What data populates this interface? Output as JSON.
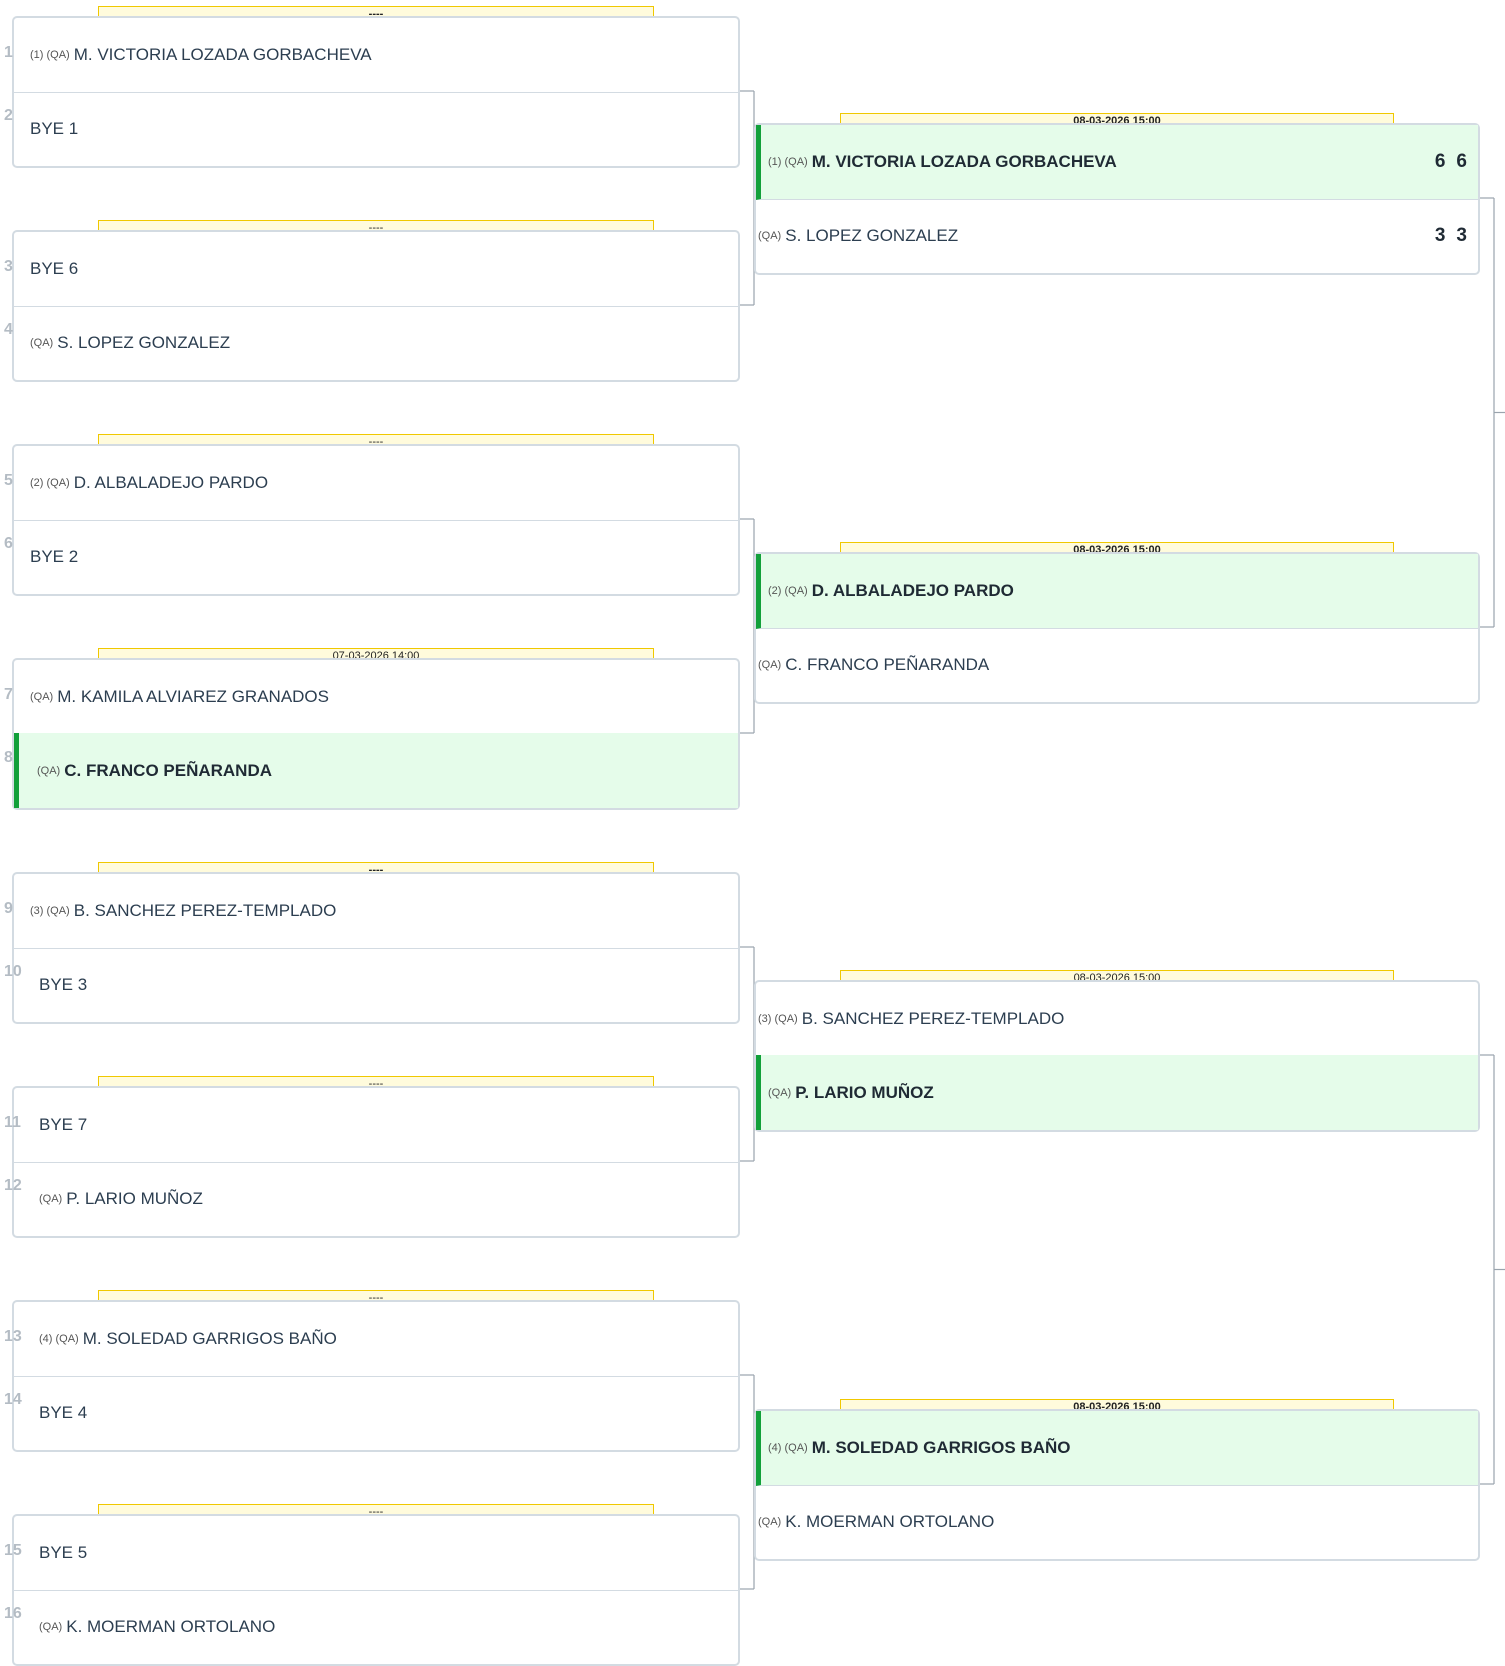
{
  "colors": {
    "winner_bg": "#e5fcea",
    "winner_bar": "#12a03a",
    "date_bg": "#fffbdc",
    "date_border": "#f0c800",
    "box_border": "#d3dbe2"
  },
  "rounds": [
    {
      "matches": [
        {
          "date": "----",
          "date_bold": true,
          "top": {
            "pos": "1",
            "seed": "(1) (QA)",
            "name": "M. VICTORIA LOZADA GORBACHEVA"
          },
          "bottom": {
            "pos": "2",
            "seed": "",
            "name": "BYE 1"
          }
        },
        {
          "date": "----",
          "date_bold": false,
          "top": {
            "pos": "3",
            "seed": "",
            "name": "BYE 6"
          },
          "bottom": {
            "pos": "4",
            "seed": "(QA)",
            "name": "S. LOPEZ GONZALEZ"
          }
        },
        {
          "date": "----",
          "date_bold": false,
          "top": {
            "pos": "5",
            "seed": "(2) (QA)",
            "name": "D. ALBALADEJO PARDO"
          },
          "bottom": {
            "pos": "6",
            "seed": "",
            "name": "BYE 2"
          }
        },
        {
          "date": "07-03-2026 14:00",
          "date_bold": false,
          "top": {
            "pos": "7",
            "seed": "(QA)",
            "name": "M. KAMILA ALVIAREZ GRANADOS"
          },
          "bottom": {
            "pos": "8",
            "seed": "(QA)",
            "name": "C. FRANCO PEÑARANDA",
            "winner": true
          }
        },
        {
          "date": "----",
          "date_bold": true,
          "top": {
            "pos": "9",
            "seed": "(3) (QA)",
            "name": "B. SANCHEZ PEREZ-TEMPLADO"
          },
          "bottom": {
            "pos": "10",
            "seed": "",
            "name": "BYE 3"
          }
        },
        {
          "date": "----",
          "date_bold": false,
          "top": {
            "pos": "11",
            "seed": "",
            "name": "BYE 7"
          },
          "bottom": {
            "pos": "12",
            "seed": "(QA)",
            "name": "P. LARIO MUÑOZ"
          }
        },
        {
          "date": "----",
          "date_bold": false,
          "top": {
            "pos": "13",
            "seed": "(4) (QA)",
            "name": "M. SOLEDAD GARRIGOS BAÑO"
          },
          "bottom": {
            "pos": "14",
            "seed": "",
            "name": "BYE 4"
          }
        },
        {
          "date": "----",
          "date_bold": false,
          "top": {
            "pos": "15",
            "seed": "",
            "name": "BYE 5"
          },
          "bottom": {
            "pos": "16",
            "seed": "(QA)",
            "name": "K. MOERMAN ORTOLANO"
          }
        }
      ]
    },
    {
      "matches": [
        {
          "date": "08-03-2026 15:00",
          "date_bold": true,
          "top": {
            "seed": "(1) (QA)",
            "name": "M. VICTORIA LOZADA GORBACHEVA",
            "winner": true,
            "scores": [
              "6",
              "6"
            ]
          },
          "bottom": {
            "seed": "(QA)",
            "name": "S. LOPEZ GONZALEZ",
            "scores": [
              "3",
              "3"
            ]
          }
        },
        {
          "date": "08-03-2026 15:00",
          "date_bold": true,
          "top": {
            "seed": "(2) (QA)",
            "name": "D. ALBALADEJO PARDO",
            "winner": true
          },
          "bottom": {
            "seed": "(QA)",
            "name": "C. FRANCO PEÑARANDA"
          }
        },
        {
          "date": "08-03-2026 15:00",
          "date_bold": false,
          "top": {
            "seed": "(3) (QA)",
            "name": "B. SANCHEZ PEREZ-TEMPLADO"
          },
          "bottom": {
            "seed": "(QA)",
            "name": "P. LARIO MUÑOZ",
            "winner": true
          }
        },
        {
          "date": "08-03-2026 15:00",
          "date_bold": true,
          "top": {
            "seed": "(4) (QA)",
            "name": "M. SOLEDAD GARRIGOS BAÑO",
            "winner": true
          },
          "bottom": {
            "seed": "(QA)",
            "name": "K. MOERMAN ORTOLANO"
          }
        }
      ]
    }
  ]
}
